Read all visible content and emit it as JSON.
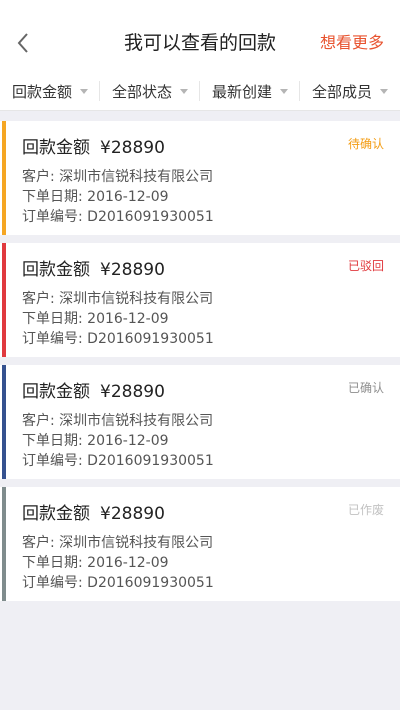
{
  "header": {
    "title": "我可以查看的回款",
    "action": "想看更多"
  },
  "filters": [
    {
      "label": "回款金额"
    },
    {
      "label": "全部状态"
    },
    {
      "label": "最新创建"
    },
    {
      "label": "全部成员"
    }
  ],
  "records": [
    {
      "amount_label": "回款金额",
      "amount": "¥28890",
      "status": "待确认",
      "status_color": "#f39c12",
      "stripe_color": "#f5a623",
      "customer": "客户: 深圳市信锐科技有限公司",
      "date": "下单日期: 2016-12-09",
      "order": "订单编号: D2016091930051"
    },
    {
      "amount_label": "回款金额",
      "amount": "¥28890",
      "status": "已驳回",
      "status_color": "#e0393e",
      "stripe_color": "#e0393e",
      "customer": "客户: 深圳市信锐科技有限公司",
      "date": "下单日期: 2016-12-09",
      "order": "订单编号: D2016091930051"
    },
    {
      "amount_label": "回款金额",
      "amount": "¥28890",
      "status": "已确认",
      "status_color": "#8e8e8e",
      "stripe_color": "#35518f",
      "customer": "客户: 深圳市信锐科技有限公司",
      "date": "下单日期: 2016-12-09",
      "order": "订单编号: D2016091930051"
    },
    {
      "amount_label": "回款金额",
      "amount": "¥28890",
      "status": "已作废",
      "status_color": "#c2c2c2",
      "stripe_color": "#7f8c8d",
      "customer": "客户: 深圳市信锐科技有限公司",
      "date": "下单日期: 2016-12-09",
      "order": "订单编号: D2016091930051"
    }
  ],
  "colors": {
    "accent": "#e8532f",
    "background": "#efeff4"
  }
}
